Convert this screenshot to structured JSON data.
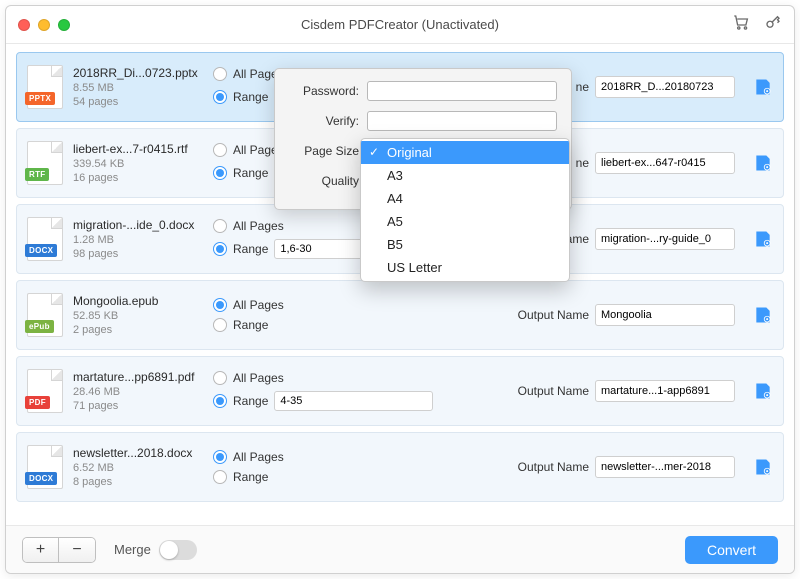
{
  "window": {
    "title": "Cisdem PDFCreator (Unactivated)"
  },
  "toolbar": {
    "cart_icon": "cart-icon",
    "key_icon": "key-icon"
  },
  "radio_labels": {
    "all": "All Pages",
    "range": "Range"
  },
  "output_label": "Output Name",
  "short_output_label": "ne",
  "files": [
    {
      "icon_label": "PPTX",
      "icon_color": "#f4652a",
      "name": "2018RR_Di...0723.pptx",
      "size": "8.55 MB",
      "pages": "54 pages",
      "mode": "range",
      "range": "",
      "output": "2018RR_D...20180723",
      "selected": true
    },
    {
      "icon_label": "RTF",
      "icon_color": "#5fb64a",
      "name": "liebert-ex...7-r0415.rtf",
      "size": "339.54 KB",
      "pages": "16 pages",
      "mode": "range",
      "range": "",
      "output": "liebert-ex...647-r0415",
      "selected": false
    },
    {
      "icon_label": "DOCX",
      "icon_color": "#2e7bd6",
      "name": "migration-...ide_0.docx",
      "size": "1.28 MB",
      "pages": "98 pages",
      "mode": "range",
      "range": "1,6-30",
      "output": "migration-...ry-guide_0",
      "selected": false
    },
    {
      "icon_label": "ePub",
      "icon_color": "#7cb342",
      "name": "Mongoolia.epub",
      "size": "52.85 KB",
      "pages": "2 pages",
      "mode": "all",
      "range": "",
      "output": "Mongoolia",
      "selected": false
    },
    {
      "icon_label": "PDF",
      "icon_color": "#e8413a",
      "name": "martature...pp6891.pdf",
      "size": "28.46 MB",
      "pages": "71 pages",
      "mode": "range",
      "range": "4-35",
      "output": "martature...1-app6891",
      "selected": false
    },
    {
      "icon_label": "DOCX",
      "icon_color": "#2e7bd6",
      "name": "newsletter...2018.docx",
      "size": "6.52 MB",
      "pages": "8 pages",
      "mode": "all",
      "range": "",
      "output": "newsletter-...mer-2018",
      "selected": false
    }
  ],
  "popup": {
    "password_label": "Password:",
    "verify_label": "Verify:",
    "pagesize_label": "Page Size",
    "quality_label": "Quality"
  },
  "pagesize_options": [
    "Original",
    "A3",
    "A4",
    "A5",
    "B5",
    "US Letter"
  ],
  "pagesize_selected": "Original",
  "footer": {
    "merge_label": "Merge",
    "convert_label": "Convert",
    "plus": "+",
    "minus": "−"
  }
}
